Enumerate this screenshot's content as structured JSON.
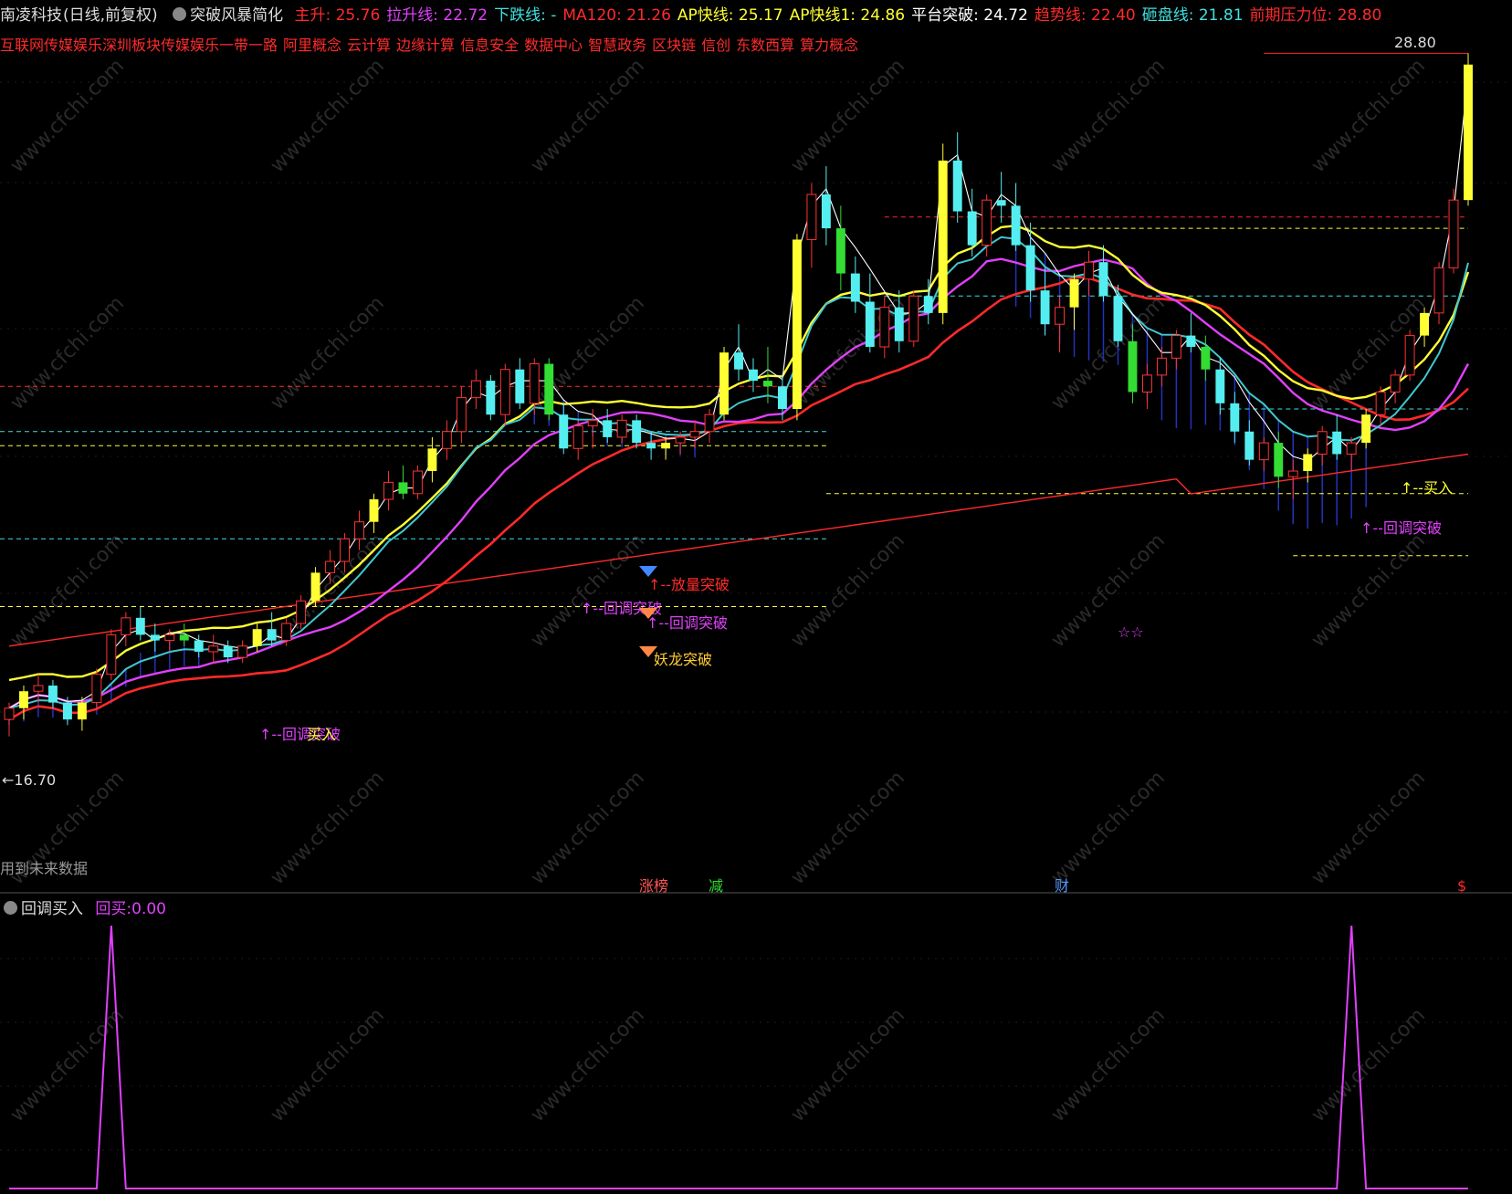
{
  "header": {
    "stock": "南凌科技",
    "period": "(日线,前复权)",
    "indicator": "突破风暴简化",
    "items": [
      {
        "label": "主升:",
        "value": "25.76",
        "color": "#ff2a2a"
      },
      {
        "label": "拉升线:",
        "value": "22.72",
        "color": "#e040fb"
      },
      {
        "label": "下跌线:",
        "value": "-",
        "color": "#40e0e0"
      },
      {
        "label": "MA120:",
        "value": "21.26",
        "color": "#ff2a2a"
      },
      {
        "label": "AP快线:",
        "value": "25.17",
        "color": "#ffff33"
      },
      {
        "label": "AP快线1:",
        "value": "24.86",
        "color": "#ffff33"
      },
      {
        "label": "平台突破:",
        "value": "24.72",
        "color": "#ffffff"
      },
      {
        "label": "趋势线:",
        "value": "22.40",
        "color": "#ff2a2a"
      },
      {
        "label": "砸盘线:",
        "value": "21.81",
        "color": "#40e0e0"
      },
      {
        "label": "前期压力位:",
        "value": "28.80",
        "color": "#ff2a2a"
      }
    ]
  },
  "concepts": [
    "互联网传媒娱乐深圳板块传媒娱乐一带一路",
    "阿里概念",
    "云计算",
    "边缘计算",
    "信息安全",
    "数据中心",
    "智慧政务",
    "区块链",
    "信创",
    "东数西算",
    "算力概念"
  ],
  "main_chart": {
    "price_high_label": "28.80",
    "price_low_label": "←16.70",
    "future_data_note": "用到未来数据",
    "signals": [
      {
        "text": "↑--放量突破",
        "color": "#ff2a2a"
      },
      {
        "text": "↑--回调突破",
        "color": "#e040fb"
      },
      {
        "text": "↑--回调突破",
        "color": "#e040fb"
      },
      {
        "text": "妖龙突破",
        "color": "#ffcc33"
      },
      {
        "text": "↑--回调突破",
        "color": "#e040fb"
      },
      {
        "text": "↑--回调突破",
        "color": "#e040fb"
      },
      {
        "text": "↑--买入",
        "color": "#ffff33"
      },
      {
        "text": "买入",
        "color": "#ffff33"
      }
    ],
    "badges": [
      {
        "text": "涨榜",
        "color": "#ff5555"
      },
      {
        "text": "减",
        "color": "#33dd33"
      },
      {
        "text": "财",
        "color": "#5599ff"
      },
      {
        "text": "$",
        "color": "#ff2a2a"
      }
    ],
    "stars": "☆☆",
    "watermark": "www.cfchi.com"
  },
  "sub_indicator": {
    "name": "回调买入",
    "label": "回买:",
    "value": "0.00"
  },
  "chart_data": {
    "type": "candlestick",
    "title": "南凌科技 (日线,前复权)",
    "ylim": [
      16.0,
      29.0
    ],
    "high_marker": 28.8,
    "low_marker": 16.7,
    "candles": [
      [
        17.0,
        17.3,
        16.7,
        17.2
      ],
      [
        17.2,
        17.6,
        17.0,
        17.5
      ],
      [
        17.5,
        17.8,
        17.3,
        17.6
      ],
      [
        17.6,
        17.7,
        17.2,
        17.3
      ],
      [
        17.3,
        17.4,
        16.9,
        17.0
      ],
      [
        17.0,
        17.4,
        16.8,
        17.3
      ],
      [
        17.3,
        17.9,
        17.2,
        17.8
      ],
      [
        17.8,
        18.6,
        17.7,
        18.5
      ],
      [
        18.5,
        18.9,
        18.3,
        18.8
      ],
      [
        18.8,
        19.0,
        18.4,
        18.5
      ],
      [
        18.5,
        18.7,
        18.2,
        18.4
      ],
      [
        18.4,
        18.6,
        18.2,
        18.5
      ],
      [
        18.5,
        18.7,
        18.3,
        18.4
      ],
      [
        18.4,
        18.5,
        18.1,
        18.2
      ],
      [
        18.2,
        18.5,
        18.0,
        18.3
      ],
      [
        18.3,
        18.4,
        18.0,
        18.1
      ],
      [
        18.1,
        18.4,
        18.0,
        18.3
      ],
      [
        18.3,
        18.7,
        18.2,
        18.6
      ],
      [
        18.6,
        18.9,
        18.3,
        18.4
      ],
      [
        18.4,
        18.8,
        18.3,
        18.7
      ],
      [
        18.7,
        19.2,
        18.6,
        19.1
      ],
      [
        19.1,
        19.7,
        19.0,
        19.6
      ],
      [
        19.6,
        20.0,
        19.4,
        19.8
      ],
      [
        19.8,
        20.3,
        19.6,
        20.2
      ],
      [
        20.2,
        20.7,
        20.0,
        20.5
      ],
      [
        20.5,
        21.0,
        20.3,
        20.9
      ],
      [
        20.9,
        21.4,
        20.7,
        21.2
      ],
      [
        21.2,
        21.5,
        20.9,
        21.0
      ],
      [
        21.0,
        21.5,
        20.9,
        21.4
      ],
      [
        21.4,
        22.0,
        21.2,
        21.8
      ],
      [
        21.8,
        22.3,
        21.6,
        22.1
      ],
      [
        22.1,
        22.9,
        21.9,
        22.7
      ],
      [
        22.7,
        23.2,
        22.5,
        23.0
      ],
      [
        23.0,
        23.1,
        22.3,
        22.4
      ],
      [
        22.4,
        23.3,
        22.2,
        23.2
      ],
      [
        23.2,
        23.4,
        22.5,
        22.6
      ],
      [
        22.6,
        23.4,
        22.4,
        23.3
      ],
      [
        23.3,
        23.4,
        22.3,
        22.4
      ],
      [
        22.4,
        22.6,
        21.7,
        21.8
      ],
      [
        21.8,
        22.3,
        21.6,
        22.2
      ],
      [
        22.2,
        22.5,
        21.8,
        22.3
      ],
      [
        22.3,
        22.5,
        21.9,
        22.0
      ],
      [
        22.0,
        22.4,
        21.9,
        22.3
      ],
      [
        22.3,
        22.4,
        21.8,
        21.9
      ],
      [
        21.9,
        22.1,
        21.6,
        21.8
      ],
      [
        21.8,
        22.0,
        21.6,
        21.9
      ],
      [
        21.9,
        22.1,
        21.7,
        22.0
      ],
      [
        22.0,
        22.3,
        21.8,
        22.1
      ],
      [
        22.1,
        22.5,
        21.9,
        22.4
      ],
      [
        22.4,
        23.6,
        22.3,
        23.5
      ],
      [
        23.5,
        24.0,
        23.0,
        23.2
      ],
      [
        23.2,
        23.4,
        22.8,
        23.0
      ],
      [
        23.0,
        23.6,
        22.6,
        22.9
      ],
      [
        22.9,
        23.1,
        22.3,
        22.5
      ],
      [
        22.5,
        25.6,
        22.3,
        25.5
      ],
      [
        25.5,
        26.5,
        25.0,
        26.3
      ],
      [
        26.3,
        26.8,
        25.4,
        25.7
      ],
      [
        25.7,
        26.1,
        24.6,
        24.9
      ],
      [
        24.9,
        25.2,
        24.2,
        24.4
      ],
      [
        24.4,
        24.9,
        23.5,
        23.6
      ],
      [
        23.6,
        24.5,
        23.4,
        24.3
      ],
      [
        24.3,
        24.6,
        23.5,
        23.7
      ],
      [
        23.7,
        24.6,
        23.6,
        24.5
      ],
      [
        24.5,
        24.8,
        24.0,
        24.2
      ],
      [
        24.2,
        27.2,
        24.0,
        26.9
      ],
      [
        26.9,
        27.4,
        25.8,
        26.0
      ],
      [
        26.0,
        26.4,
        25.2,
        25.4
      ],
      [
        25.4,
        26.3,
        25.2,
        26.2
      ],
      [
        26.2,
        26.7,
        25.8,
        26.1
      ],
      [
        26.1,
        26.5,
        25.3,
        25.4
      ],
      [
        25.4,
        25.8,
        24.4,
        24.6
      ],
      [
        24.6,
        25.0,
        23.8,
        24.0
      ],
      [
        24.0,
        24.5,
        23.5,
        24.3
      ],
      [
        24.3,
        24.9,
        23.9,
        24.8
      ],
      [
        24.8,
        25.3,
        24.5,
        25.1
      ],
      [
        25.1,
        25.4,
        24.4,
        24.5
      ],
      [
        24.5,
        24.7,
        23.6,
        23.7
      ],
      [
        23.7,
        24.0,
        22.6,
        22.8
      ],
      [
        22.8,
        23.3,
        22.5,
        23.1
      ],
      [
        23.1,
        23.6,
        22.9,
        23.4
      ],
      [
        23.4,
        23.9,
        23.2,
        23.8
      ],
      [
        23.8,
        24.2,
        23.5,
        23.6
      ],
      [
        23.6,
        23.8,
        23.0,
        23.2
      ],
      [
        23.2,
        23.4,
        22.4,
        22.6
      ],
      [
        22.6,
        22.8,
        21.9,
        22.1
      ],
      [
        22.1,
        22.3,
        21.5,
        21.6
      ],
      [
        21.6,
        22.0,
        21.4,
        21.9
      ],
      [
        21.9,
        22.1,
        21.1,
        21.3
      ],
      [
        21.3,
        21.6,
        20.9,
        21.4
      ],
      [
        21.4,
        21.8,
        21.2,
        21.7
      ],
      [
        21.7,
        22.2,
        21.5,
        22.1
      ],
      [
        22.1,
        22.4,
        21.6,
        21.7
      ],
      [
        21.7,
        22.0,
        21.4,
        21.9
      ],
      [
        21.9,
        22.5,
        21.8,
        22.4
      ],
      [
        22.4,
        22.9,
        22.2,
        22.8
      ],
      [
        22.8,
        23.2,
        22.6,
        23.1
      ],
      [
        23.1,
        23.9,
        23.0,
        23.8
      ],
      [
        23.8,
        24.3,
        23.6,
        24.2
      ],
      [
        24.2,
        25.1,
        24.0,
        25.0
      ],
      [
        25.0,
        26.4,
        24.9,
        26.2
      ],
      [
        26.2,
        28.8,
        26.1,
        28.6
      ]
    ],
    "sub_series": {
      "name": "回买",
      "peaks_at_index": [
        7,
        92
      ],
      "values_range": [
        0,
        1
      ]
    }
  }
}
